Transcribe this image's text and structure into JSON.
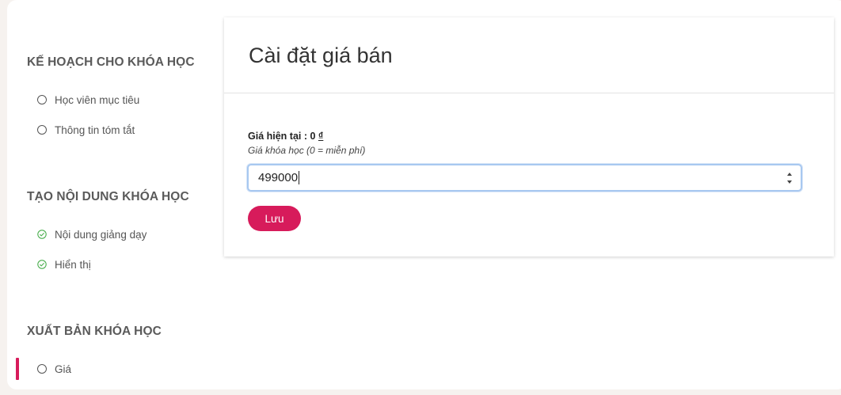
{
  "sidebar": {
    "sections": [
      {
        "title": "KẾ HOẠCH CHO KHÓA HỌC",
        "items": [
          {
            "label": "Học viên mục tiêu",
            "status": "incomplete"
          },
          {
            "label": "Thông tin tóm tắt",
            "status": "incomplete"
          }
        ]
      },
      {
        "title": "TẠO NỘI DUNG KHÓA HỌC",
        "items": [
          {
            "label": "Nội dung giảng dạy",
            "status": "complete"
          },
          {
            "label": "Hiển thị",
            "status": "complete"
          }
        ]
      },
      {
        "title": "XUẤT BẢN KHÓA HỌC",
        "items": [
          {
            "label": "Giá",
            "status": "incomplete",
            "active": true
          }
        ]
      }
    ]
  },
  "card": {
    "title": "Cài đặt giá bán",
    "current_price_label": "Giá hiện tại : 0",
    "currency_symbol": "₫",
    "price_hint": "Giá khóa học (0 = miễn phí)",
    "price_value": "499000",
    "save_label": "Lưu"
  },
  "colors": {
    "accent": "#d71b5b",
    "check_green": "#4caf50",
    "input_focus": "#a8c8f0"
  },
  "icons": {
    "incomplete": "circle-icon",
    "complete": "check-circle-icon",
    "spinner": "spinner-arrows-icon"
  }
}
